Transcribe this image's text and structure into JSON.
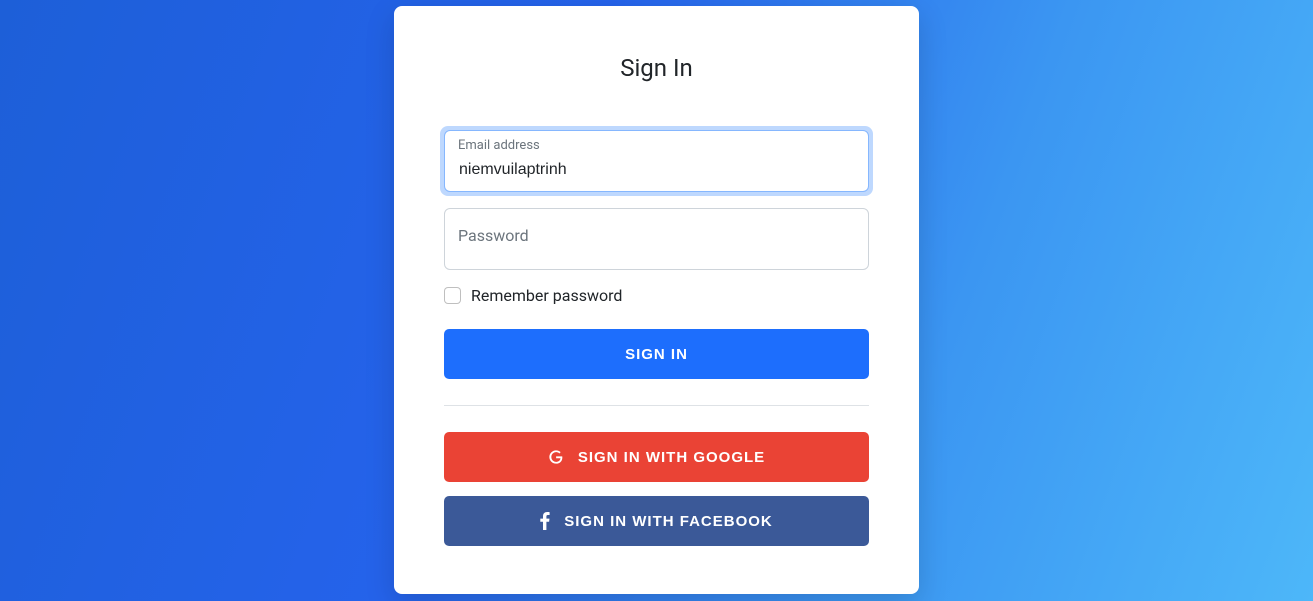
{
  "form": {
    "title": "Sign In",
    "email": {
      "label": "Email address",
      "value": "niemvuilaptrinh"
    },
    "password": {
      "label": "Password",
      "value": ""
    },
    "remember": {
      "label": "Remember password",
      "checked": false
    },
    "buttons": {
      "signin": "Sign in",
      "google": "Sign in with Google",
      "facebook": "Sign in with Facebook"
    }
  },
  "colors": {
    "primary": "#1d6efd",
    "google": "#ea4335",
    "facebook": "#3b5998"
  }
}
